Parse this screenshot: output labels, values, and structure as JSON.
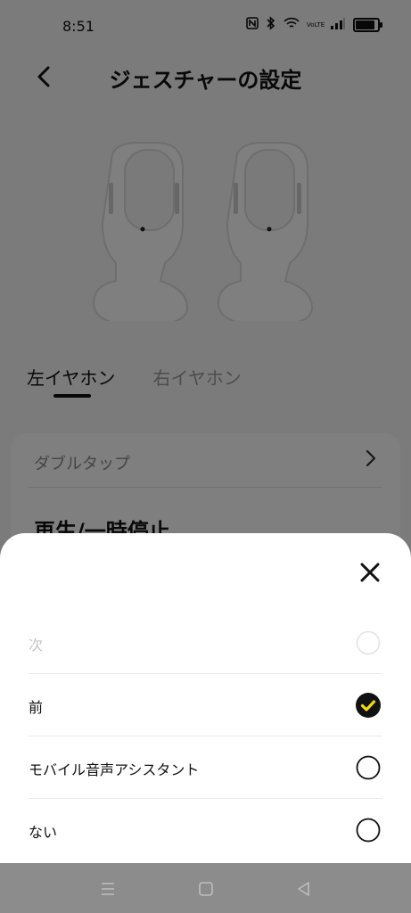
{
  "status_bar": {
    "time": "8:51",
    "icons": [
      "nfc-icon",
      "bluetooth-icon",
      "wifi-icon",
      "volte-icon",
      "signal-icon",
      "battery-icon"
    ],
    "volte_text": "VoLTE"
  },
  "header": {
    "title": "ジェスチャーの設定",
    "back_icon": "back-arrow-icon"
  },
  "ear_tabs": [
    {
      "label": "左イヤホン",
      "active": true
    },
    {
      "label": "右イヤホン",
      "active": false
    }
  ],
  "gesture_card": {
    "gesture_label": "ダブルタップ",
    "current_action": "再生/一時停止"
  },
  "sheet": {
    "close_icon": "close-icon",
    "options": [
      {
        "label": "次",
        "state": "disabled"
      },
      {
        "label": "前",
        "state": "selected"
      },
      {
        "label": "モバイル音声アシスタント",
        "state": "unselected"
      },
      {
        "label": "ない",
        "state": "unselected"
      }
    ]
  },
  "nav_bar": {
    "buttons": [
      "menu-icon",
      "home-icon",
      "back-icon"
    ]
  },
  "colors": {
    "accent": "#f5d90a",
    "text": "#111111",
    "disabled": "#c4c4c4",
    "scrim": "rgba(0,0,0,0.5)",
    "nav_bar": "#8c8c8c"
  }
}
